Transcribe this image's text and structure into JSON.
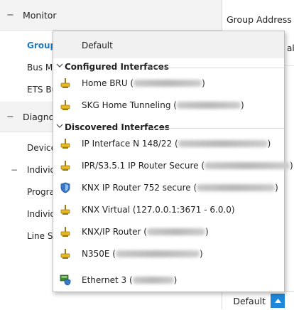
{
  "nav": {
    "monitor": {
      "toggle": "−",
      "title": "Monitor"
    },
    "monitor_items": [
      "Group",
      "Bus Mo",
      "ETS Bu"
    ],
    "diagnostics": {
      "toggle": "−",
      "title": "Diagnos"
    },
    "diag_items": [
      "Device",
      "Individ",
      "Progra",
      "Individ",
      "Line Sc"
    ],
    "individual_toggle": "−"
  },
  "right_pane": {
    "column_header": "Group Address",
    "column_header2": "alu"
  },
  "bottom_bar": {
    "value": "Default",
    "up_icon": "triangle-up-icon"
  },
  "dropdown": {
    "default_label": "Default",
    "groups": [
      {
        "label": "Configured Interfaces",
        "items": [
          {
            "name": "Home BRU (",
            "suffix": ")",
            "icon": "network-interface-icon"
          },
          {
            "name": "SKG Home Tunneling (",
            "suffix": ")",
            "icon": "network-interface-icon"
          }
        ]
      },
      {
        "label": "Discovered Interfaces",
        "items": [
          {
            "name": "IP Interface N 148/22 (",
            "suffix": ")",
            "icon": "network-interface-icon"
          },
          {
            "name": "IPR/S3.5.1 IP Router Secure (",
            "suffix": ")",
            "icon": "network-interface-icon"
          },
          {
            "name": "KNX IP Router 752 secure (",
            "suffix": ")",
            "icon": "secure-router-shield-icon"
          },
          {
            "name": "KNX Virtual  (127.0.0.1:3671 - 6.0.0)",
            "suffix": "",
            "icon": "network-interface-icon"
          },
          {
            "name": "KNX/IP Router (",
            "suffix": ")",
            "icon": "network-interface-icon"
          },
          {
            "name": "N350E (",
            "suffix": ")",
            "icon": "network-interface-icon"
          },
          {
            "name": "Ethernet 3 (",
            "suffix": ")",
            "icon": "ethernet-shield-icon"
          }
        ]
      }
    ]
  },
  "colors": {
    "accent": "#1e7bc4",
    "button": "#1e88d8",
    "icon_yellow": "#e8b923",
    "shield_blue": "#3a78c9"
  }
}
